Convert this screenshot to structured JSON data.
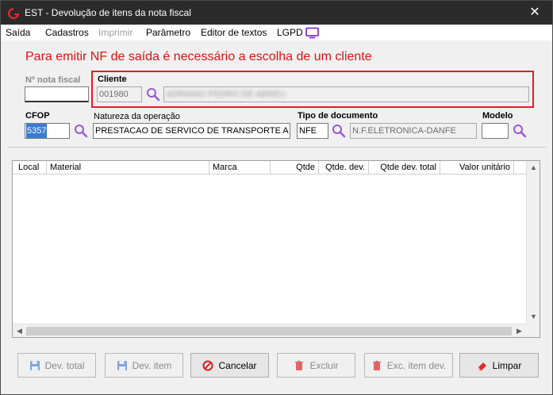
{
  "window": {
    "title": "EST - Devolução de itens da nota fiscal",
    "close_glyph": "✕"
  },
  "menu": {
    "items": [
      "Saída",
      "Cadastros",
      "Imprimir",
      "Parâmetro",
      "Editor de textos",
      "LGPD"
    ]
  },
  "banner": "Para emitir NF de saída é necessário a escolha de um cliente",
  "form": {
    "nota_label": "Nº nota fiscal",
    "nota_value": "",
    "cliente_label": "Cliente",
    "cliente_code": "001980",
    "cliente_name": "ADRIANO PEDRO DE ABREU",
    "cfop_label": "CFOP",
    "cfop_value": "5357",
    "natureza_label": "Natureza da operação",
    "natureza_value": "PRESTACAO DE SERVICO DE TRANSPORTE A NAO",
    "tipo_label": "Tipo de documento",
    "tipo_value": "NFE",
    "tipo_desc": "N.F.ELETRONICA-DANFE",
    "modelo_label": "Modelo",
    "modelo_value": ""
  },
  "grid": {
    "columns": [
      "Local",
      "Material",
      "Marca",
      "Qtde",
      "Qtde. dev.",
      "Qtde dev. total",
      "Valor unitário"
    ]
  },
  "buttons": {
    "dev_total": "Dev. total",
    "dev_item": "Dev. item",
    "cancelar": "Cancelar",
    "excluir": "Excluir",
    "exc_item_dev": "Exc. item dev.",
    "limpar": "Limpar"
  },
  "colors": {
    "banner": "#e01010",
    "highlight_box": "#e02020",
    "magnifier": "#9b59d0",
    "cancel_icon": "#d42020",
    "save_icon": "#2a6fc9"
  }
}
